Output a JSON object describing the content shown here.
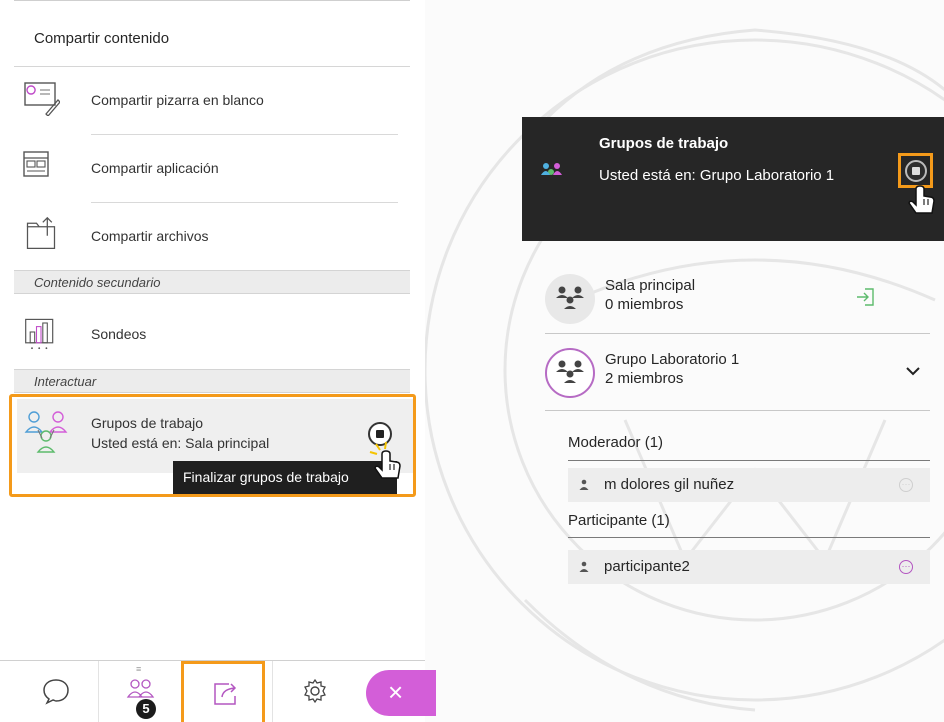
{
  "left_panel": {
    "title": "Compartir contenido",
    "items": [
      {
        "label": "Compartir pizarra en blanco",
        "icon": "whiteboard-icon"
      },
      {
        "label": "Compartir aplicación",
        "icon": "application-window-icon"
      },
      {
        "label": "Compartir archivos",
        "icon": "folder-upload-icon"
      }
    ],
    "secondary_header": "Contenido secundario",
    "secondary_items": [
      {
        "label": "Sondeos",
        "icon": "poll-chart-icon"
      }
    ],
    "interact_header": "Interactuar",
    "groups": {
      "title": "Grupos de trabajo",
      "status": "Usted está en: Sala principal",
      "icon": "breakout-groups-icon",
      "tooltip": "Finalizar grupos de trabajo"
    },
    "tabs": [
      {
        "name": "chat",
        "icon": "chat-bubble-icon"
      },
      {
        "name": "attendees",
        "icon": "attendees-icon",
        "badge": "5"
      },
      {
        "name": "share",
        "icon": "share-content-icon",
        "active": true
      },
      {
        "name": "settings",
        "icon": "gear-icon"
      }
    ],
    "close_label": "×",
    "colors": {
      "highlight": "#f49a1a",
      "close_pill": "#d35ed8"
    }
  },
  "right_panel": {
    "header": {
      "title": "Grupos de trabajo",
      "status": "Usted está en: Grupo Laboratorio 1"
    },
    "rooms": [
      {
        "name": "Sala principal",
        "count": "0 miembros"
      },
      {
        "name": "Grupo Laboratorio 1",
        "count": "2 miembros"
      }
    ],
    "moderator_header": "Moderador (1)",
    "moderator": "m dolores gil nuñez",
    "participant_header": "Participante (1)",
    "participant": "participante2",
    "more_label": "···",
    "colors": {
      "header_bg": "#262626",
      "accent": "#b356c1"
    }
  }
}
